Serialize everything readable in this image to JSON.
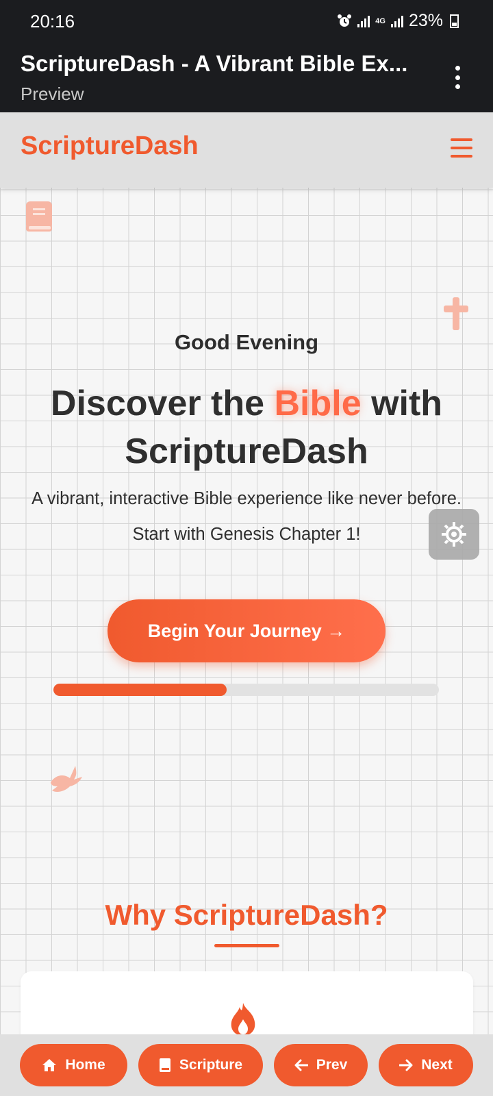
{
  "status": {
    "time": "20:16",
    "network": "4G",
    "battery": "23%"
  },
  "app": {
    "title": "ScriptureDash - A Vibrant Bible Ex...",
    "subtitle": "Preview"
  },
  "nav": {
    "brand": "ScriptureDash"
  },
  "hero": {
    "greeting": "Good Evening",
    "headline_pre": "Discover the ",
    "headline_highlight": "Bible",
    "headline_post": " with ScriptureDash",
    "description": "A vibrant, interactive Bible experience like never before. Start with Genesis Chapter 1!",
    "cta_label": "Begin Your Journey →",
    "progress_percent": 45
  },
  "section": {
    "why_title": "Why ScriptureDash?"
  },
  "bottom_nav": [
    {
      "label": "Home",
      "icon": "home-icon"
    },
    {
      "label": "Scripture",
      "icon": "book-icon"
    },
    {
      "label": "Prev",
      "icon": "arrow-left-icon"
    },
    {
      "label": "Next",
      "icon": "arrow-right-icon"
    }
  ],
  "colors": {
    "accent": "#f05a2e",
    "highlight": "#ff6a48",
    "dark": "#1b1c1f"
  }
}
